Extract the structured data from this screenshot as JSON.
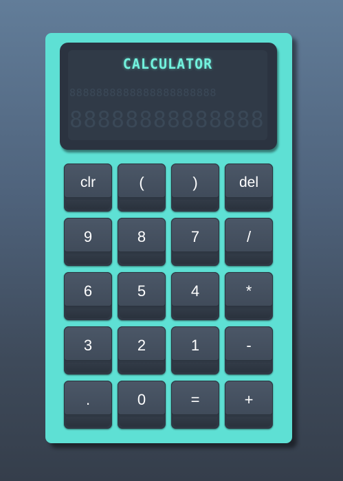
{
  "calculator": {
    "title": "CALCULATOR",
    "display_small": "8888888888888888888888",
    "display_large": "88888888888888",
    "keys": [
      [
        "clr",
        "(",
        ")",
        "del"
      ],
      [
        "9",
        "8",
        "7",
        "/"
      ],
      [
        "6",
        "5",
        "4",
        "*"
      ],
      [
        "3",
        "2",
        "1",
        "-"
      ],
      [
        ".",
        "0",
        "=",
        "+"
      ]
    ]
  },
  "colors": {
    "case": "#5ee0d4",
    "screen": "#303a47",
    "display_text": "#72f2dd",
    "key": "#434e5d",
    "key_text": "#ffffff"
  }
}
